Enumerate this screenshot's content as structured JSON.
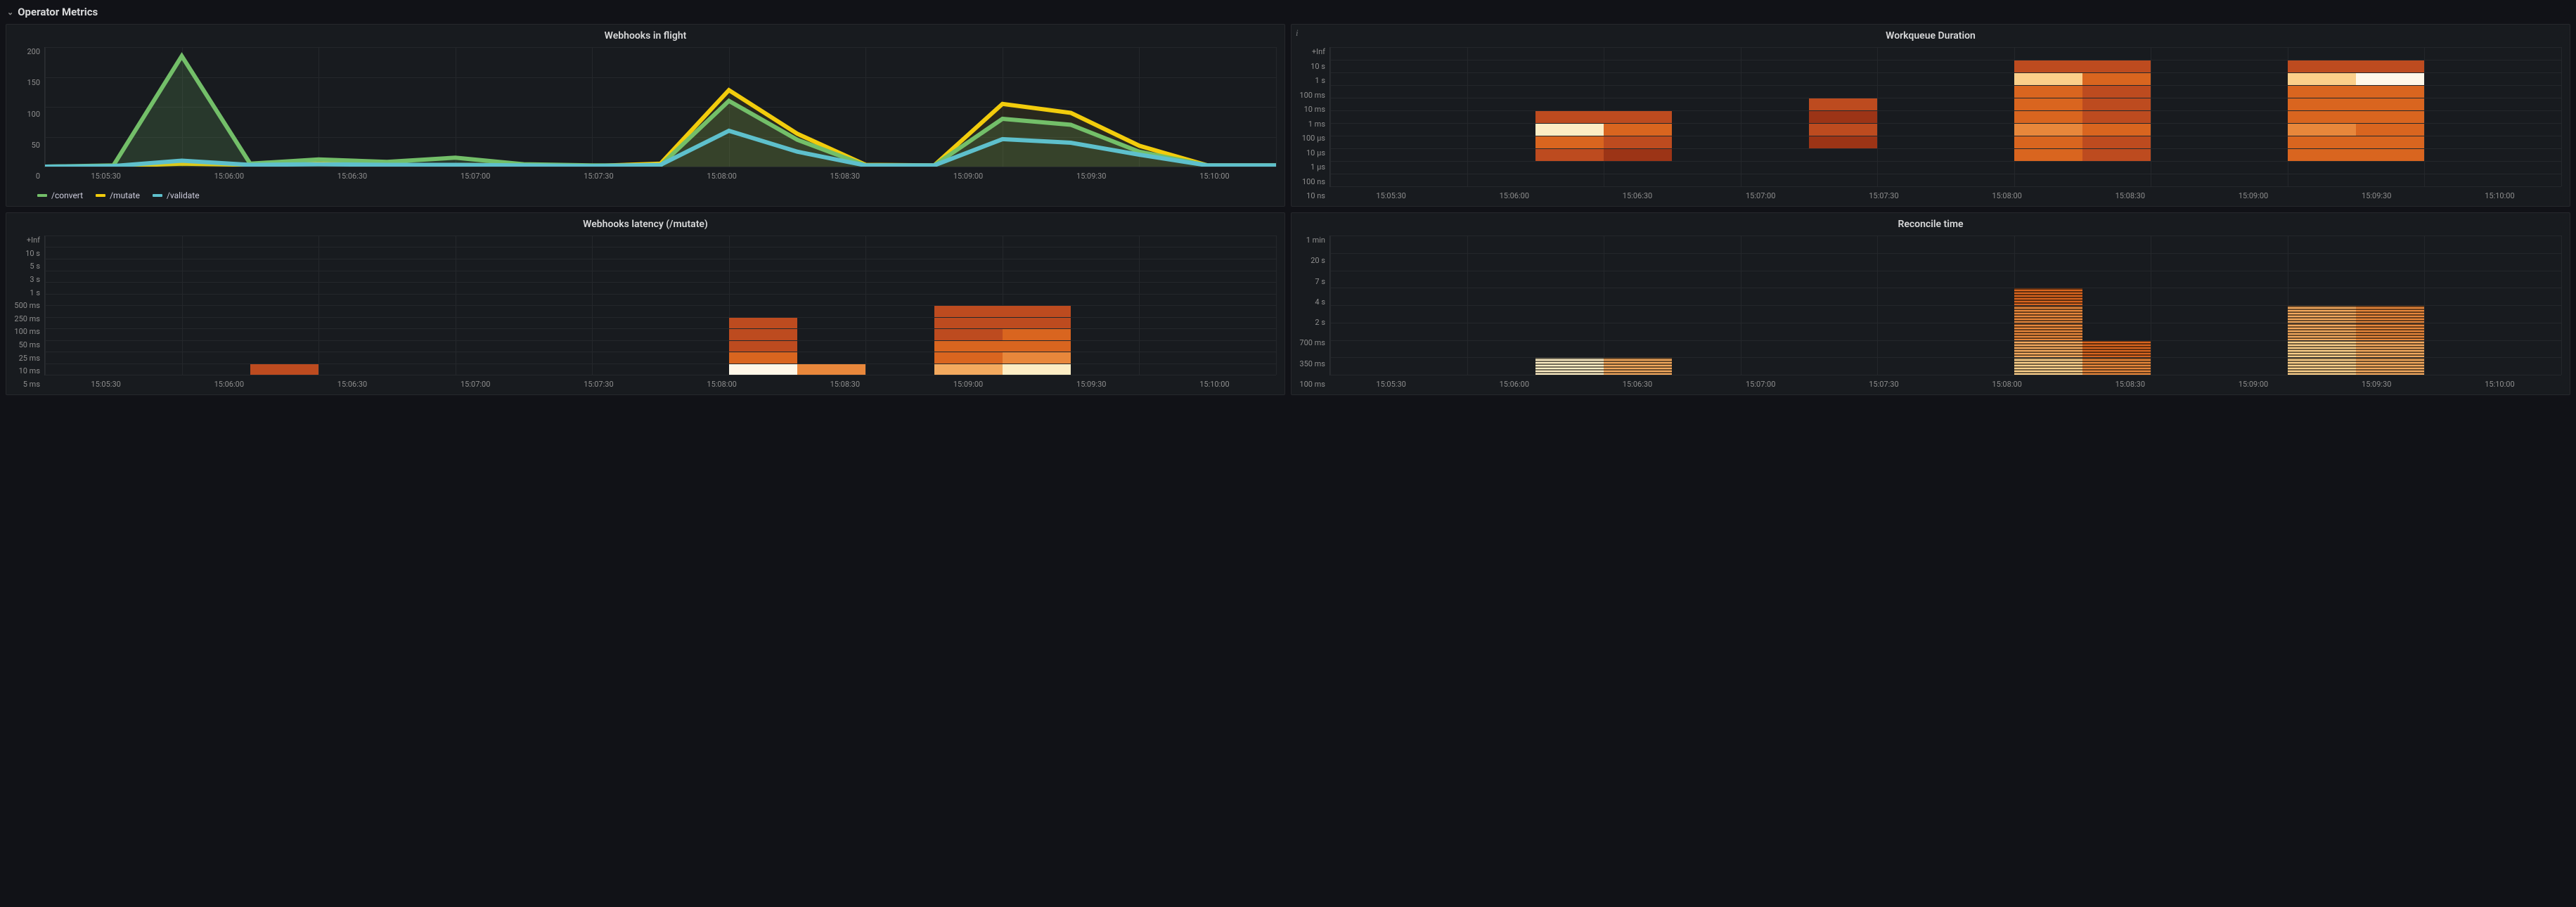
{
  "row": {
    "title": "Operator Metrics"
  },
  "panels": {
    "webhooks_in_flight": {
      "title": "Webhooks in flight",
      "legend": [
        "/convert",
        "/mutate",
        "/validate"
      ]
    },
    "workqueue_duration": {
      "title": "Workqueue Duration",
      "info": "i"
    },
    "webhooks_latency": {
      "title": "Webhooks latency (/mutate)"
    },
    "reconcile_time": {
      "title": "Reconcile time"
    }
  },
  "axes": {
    "x_ticks": [
      "15:05:30",
      "15:06:00",
      "15:06:30",
      "15:07:00",
      "15:07:30",
      "15:08:00",
      "15:08:30",
      "15:09:00",
      "15:09:30",
      "15:10:00"
    ],
    "webhooks_y": [
      "200",
      "150",
      "100",
      "50",
      "0"
    ],
    "workqueue_y": [
      "+Inf",
      "10 s",
      "1 s",
      "100 ms",
      "10 ms",
      "1 ms",
      "100 µs",
      "10 µs",
      "1 µs",
      "100 ns",
      "10 ns"
    ],
    "latency_y": [
      "+Inf",
      "10 s",
      "5 s",
      "3 s",
      "1 s",
      "500 ms",
      "250 ms",
      "100 ms",
      "50 ms",
      "25 ms",
      "10 ms",
      "5 ms"
    ],
    "reconcile_y": [
      "1 min",
      "20 s",
      "7 s",
      "4 s",
      "2 s",
      "700 ms",
      "350 ms",
      "100 ms"
    ]
  },
  "colors": {
    "convert": "#73bf69",
    "mutate": "#f2cc0c",
    "validate": "#5ec0cc",
    "heat": [
      "#5a1e0a",
      "#7a2810",
      "#9c3416",
      "#bd4b1f",
      "#d9651f",
      "#e8873b",
      "#f3a95e",
      "#fbcf8a",
      "#fdedc4",
      "#fff7e8"
    ]
  },
  "chart_data": [
    {
      "id": "webhooks_in_flight",
      "type": "line",
      "title": "Webhooks in flight",
      "xlabel": "",
      "ylabel": "",
      "ylim": [
        0,
        200
      ],
      "x": [
        "15:05:30",
        "15:05:45",
        "15:06:00",
        "15:06:15",
        "15:06:30",
        "15:06:45",
        "15:07:00",
        "15:07:15",
        "15:07:30",
        "15:07:45",
        "15:08:00",
        "15:08:15",
        "15:08:30",
        "15:08:45",
        "15:09:00",
        "15:09:15",
        "15:09:30",
        "15:09:45",
        "15:10:00"
      ],
      "series": [
        {
          "name": "/convert",
          "values": [
            0,
            2,
            185,
            5,
            12,
            8,
            15,
            4,
            2,
            2,
            110,
            45,
            2,
            2,
            80,
            70,
            25,
            2,
            2
          ]
        },
        {
          "name": "/mutate",
          "values": [
            0,
            1,
            5,
            3,
            5,
            3,
            3,
            2,
            1,
            5,
            128,
            55,
            3,
            2,
            105,
            90,
            35,
            2,
            2
          ]
        },
        {
          "name": "/validate",
          "values": [
            0,
            1,
            10,
            3,
            4,
            3,
            3,
            2,
            1,
            3,
            60,
            25,
            2,
            2,
            46,
            40,
            20,
            2,
            2
          ]
        }
      ]
    },
    {
      "id": "workqueue_duration",
      "type": "heatmap",
      "title": "Workqueue Duration",
      "xlabel": "",
      "ylabel": "",
      "x_categories": [
        "15:05:30",
        "15:06:00",
        "15:06:30",
        "15:07:00",
        "15:07:30",
        "15:08:00",
        "15:08:30",
        "15:09:00",
        "15:09:30",
        "15:10:00"
      ],
      "y_categories": [
        "10 ns",
        "100 ns",
        "1 µs",
        "10 µs",
        "100 µs",
        "1 ms",
        "10 ms",
        "100 ms",
        "1 s",
        "10 s",
        "+Inf"
      ],
      "cells": [
        {
          "x": "15:06:15",
          "y": "1 µs",
          "v": 3
        },
        {
          "x": "15:06:15",
          "y": "10 µs",
          "v": 4
        },
        {
          "x": "15:06:15",
          "y": "100 µs",
          "v": 8
        },
        {
          "x": "15:06:15",
          "y": "1 ms",
          "v": 3
        },
        {
          "x": "15:06:30",
          "y": "1 µs",
          "v": 2
        },
        {
          "x": "15:06:30",
          "y": "10 µs",
          "v": 3
        },
        {
          "x": "15:06:30",
          "y": "100 µs",
          "v": 4
        },
        {
          "x": "15:06:30",
          "y": "1 ms",
          "v": 3
        },
        {
          "x": "15:07:15",
          "y": "10 µs",
          "v": 2
        },
        {
          "x": "15:07:15",
          "y": "100 µs",
          "v": 3
        },
        {
          "x": "15:07:15",
          "y": "1 ms",
          "v": 2
        },
        {
          "x": "15:07:15",
          "y": "10 ms",
          "v": 3
        },
        {
          "x": "15:08:00",
          "y": "1 µs",
          "v": 4
        },
        {
          "x": "15:08:00",
          "y": "10 µs",
          "v": 4
        },
        {
          "x": "15:08:00",
          "y": "100 µs",
          "v": 5
        },
        {
          "x": "15:08:00",
          "y": "1 ms",
          "v": 4
        },
        {
          "x": "15:08:00",
          "y": "10 ms",
          "v": 4
        },
        {
          "x": "15:08:00",
          "y": "100 ms",
          "v": 4
        },
        {
          "x": "15:08:00",
          "y": "1 s",
          "v": 7
        },
        {
          "x": "15:08:00",
          "y": "10 s",
          "v": 3
        },
        {
          "x": "15:08:15",
          "y": "1 µs",
          "v": 3
        },
        {
          "x": "15:08:15",
          "y": "10 µs",
          "v": 3
        },
        {
          "x": "15:08:15",
          "y": "100 µs",
          "v": 4
        },
        {
          "x": "15:08:15",
          "y": "1 ms",
          "v": 3
        },
        {
          "x": "15:08:15",
          "y": "10 ms",
          "v": 3
        },
        {
          "x": "15:08:15",
          "y": "100 ms",
          "v": 3
        },
        {
          "x": "15:08:15",
          "y": "1 s",
          "v": 4
        },
        {
          "x": "15:08:15",
          "y": "10 s",
          "v": 3
        },
        {
          "x": "15:09:00",
          "y": "1 µs",
          "v": 4
        },
        {
          "x": "15:09:00",
          "y": "10 µs",
          "v": 4
        },
        {
          "x": "15:09:00",
          "y": "100 µs",
          "v": 5
        },
        {
          "x": "15:09:00",
          "y": "1 ms",
          "v": 4
        },
        {
          "x": "15:09:00",
          "y": "10 ms",
          "v": 4
        },
        {
          "x": "15:09:00",
          "y": "100 ms",
          "v": 4
        },
        {
          "x": "15:09:00",
          "y": "1 s",
          "v": 7
        },
        {
          "x": "15:09:00",
          "y": "10 s",
          "v": 3
        },
        {
          "x": "15:09:15",
          "y": "1 µs",
          "v": 4
        },
        {
          "x": "15:09:15",
          "y": "10 µs",
          "v": 4
        },
        {
          "x": "15:09:15",
          "y": "100 µs",
          "v": 4
        },
        {
          "x": "15:09:15",
          "y": "1 ms",
          "v": 4
        },
        {
          "x": "15:09:15",
          "y": "10 ms",
          "v": 4
        },
        {
          "x": "15:09:15",
          "y": "100 ms",
          "v": 4
        },
        {
          "x": "15:09:15",
          "y": "1 s",
          "v": 9
        },
        {
          "x": "15:09:15",
          "y": "10 s",
          "v": 3
        }
      ]
    },
    {
      "id": "webhooks_latency_mutate",
      "type": "heatmap",
      "title": "Webhooks latency (/mutate)",
      "xlabel": "",
      "ylabel": "",
      "x_categories": [
        "15:05:30",
        "15:06:00",
        "15:06:30",
        "15:07:00",
        "15:07:30",
        "15:08:00",
        "15:08:30",
        "15:09:00",
        "15:09:30",
        "15:10:00"
      ],
      "y_categories": [
        "5 ms",
        "10 ms",
        "25 ms",
        "50 ms",
        "100 ms",
        "250 ms",
        "500 ms",
        "1 s",
        "3 s",
        "5 s",
        "10 s",
        "+Inf"
      ],
      "cells": [
        {
          "x": "15:06:15",
          "y": "5 ms",
          "v": 3
        },
        {
          "x": "15:08:00",
          "y": "5 ms",
          "v": 9
        },
        {
          "x": "15:08:00",
          "y": "10 ms",
          "v": 4
        },
        {
          "x": "15:08:00",
          "y": "25 ms",
          "v": 3
        },
        {
          "x": "15:08:00",
          "y": "50 ms",
          "v": 3
        },
        {
          "x": "15:08:00",
          "y": "100 ms",
          "v": 3
        },
        {
          "x": "15:08:15",
          "y": "5 ms",
          "v": 5
        },
        {
          "x": "15:08:45",
          "y": "5 ms",
          "v": 6
        },
        {
          "x": "15:08:45",
          "y": "10 ms",
          "v": 4
        },
        {
          "x": "15:08:45",
          "y": "25 ms",
          "v": 4
        },
        {
          "x": "15:08:45",
          "y": "50 ms",
          "v": 3
        },
        {
          "x": "15:08:45",
          "y": "100 ms",
          "v": 3
        },
        {
          "x": "15:08:45",
          "y": "250 ms",
          "v": 3
        },
        {
          "x": "15:09:00",
          "y": "5 ms",
          "v": 8
        },
        {
          "x": "15:09:00",
          "y": "10 ms",
          "v": 5
        },
        {
          "x": "15:09:00",
          "y": "25 ms",
          "v": 4
        },
        {
          "x": "15:09:00",
          "y": "50 ms",
          "v": 4
        },
        {
          "x": "15:09:00",
          "y": "100 ms",
          "v": 3
        },
        {
          "x": "15:09:00",
          "y": "250 ms",
          "v": 3
        }
      ]
    },
    {
      "id": "reconcile_time",
      "type": "heatmap",
      "title": "Reconcile time",
      "xlabel": "",
      "ylabel": "",
      "x_categories": [
        "15:05:30",
        "15:06:00",
        "15:06:30",
        "15:07:00",
        "15:07:30",
        "15:08:00",
        "15:08:30",
        "15:09:00",
        "15:09:30",
        "15:10:00"
      ],
      "y_categories": [
        "100 ms",
        "350 ms",
        "700 ms",
        "2 s",
        "4 s",
        "7 s",
        "20 s",
        "1 min"
      ],
      "cells": [
        {
          "x": "15:06:15",
          "y": "100 ms",
          "v": 8
        },
        {
          "x": "15:06:30",
          "y": "100 ms",
          "v": 6
        },
        {
          "x": "15:08:00",
          "y": "100 ms",
          "v": 7
        },
        {
          "x": "15:08:00",
          "y": "350 ms",
          "v": 6
        },
        {
          "x": "15:08:00",
          "y": "700 ms",
          "v": 5
        },
        {
          "x": "15:08:00",
          "y": "2 s",
          "v": 5
        },
        {
          "x": "15:08:00",
          "y": "4 s",
          "v": 4
        },
        {
          "x": "15:08:15",
          "y": "100 ms",
          "v": 5
        },
        {
          "x": "15:08:15",
          "y": "350 ms",
          "v": 4
        },
        {
          "x": "15:09:00",
          "y": "100 ms",
          "v": 7
        },
        {
          "x": "15:09:00",
          "y": "350 ms",
          "v": 7
        },
        {
          "x": "15:09:00",
          "y": "700 ms",
          "v": 6
        },
        {
          "x": "15:09:00",
          "y": "2 s",
          "v": 6
        },
        {
          "x": "15:09:15",
          "y": "100 ms",
          "v": 6
        },
        {
          "x": "15:09:15",
          "y": "350 ms",
          "v": 6
        },
        {
          "x": "15:09:15",
          "y": "700 ms",
          "v": 5
        },
        {
          "x": "15:09:15",
          "y": "2 s",
          "v": 5
        }
      ]
    }
  ]
}
